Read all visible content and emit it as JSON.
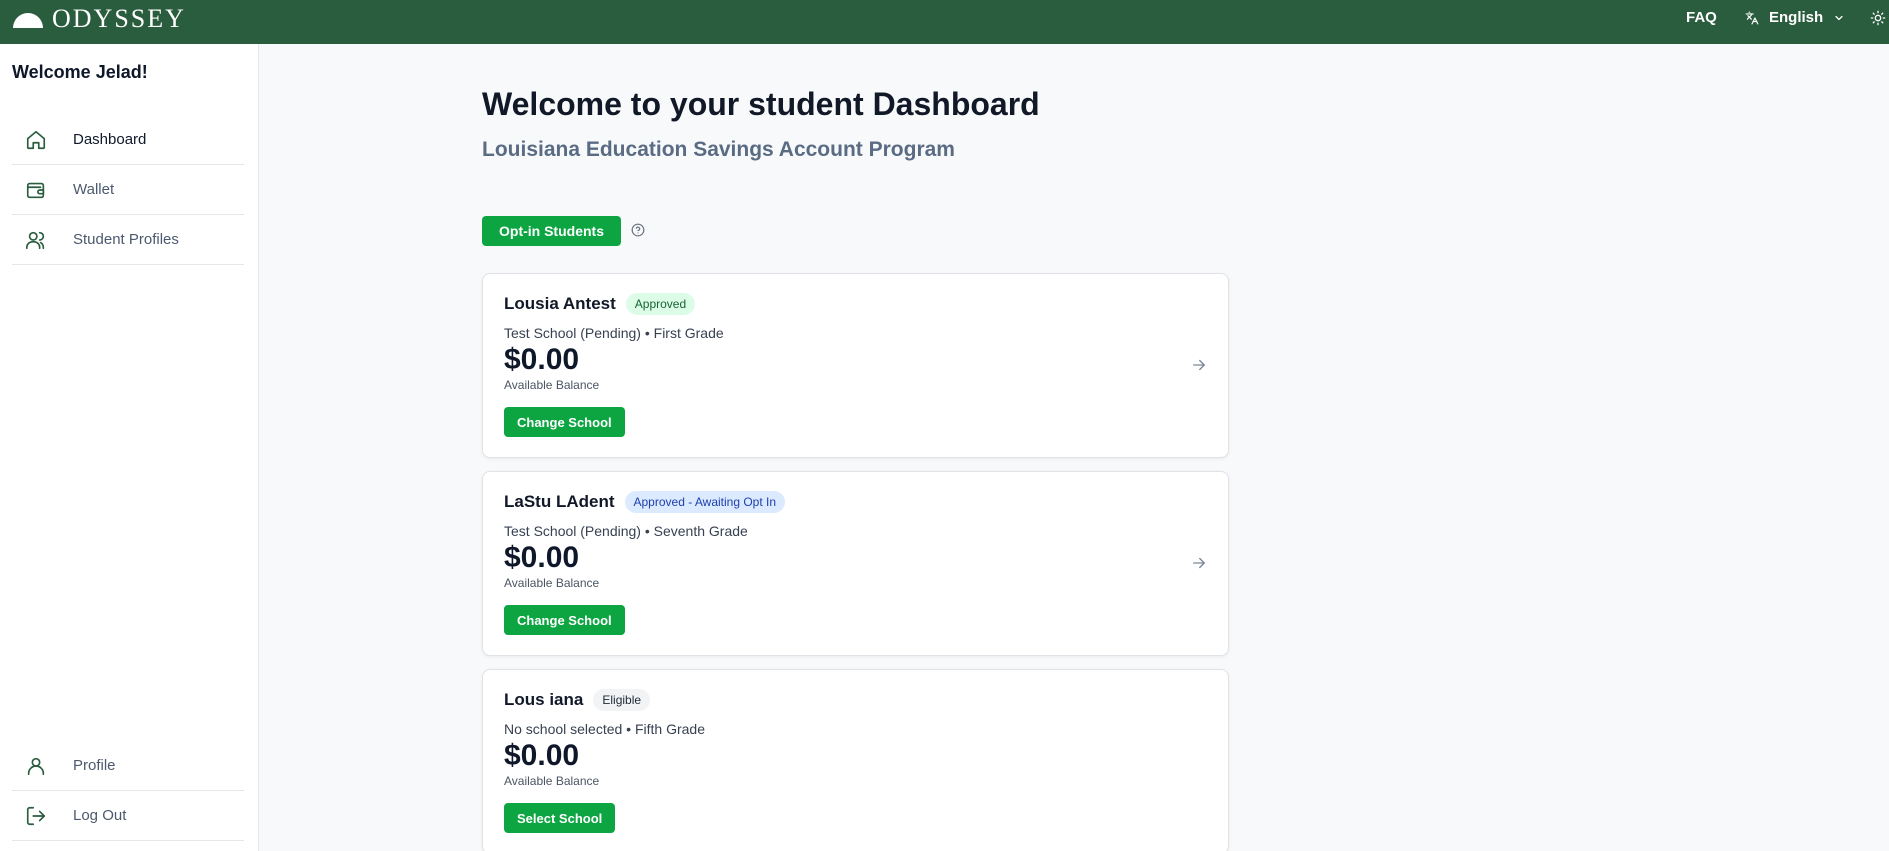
{
  "topbar": {
    "logo_text": "ODYSSEY",
    "faq": "FAQ",
    "language": "English",
    "icons": [
      "logo-dome-icon",
      "translate-icon",
      "chevron-down-icon",
      "sun-icon"
    ]
  },
  "sidebar": {
    "welcome": "Welcome Jelad!",
    "nav": [
      {
        "label": "Dashboard",
        "icon": "home-icon",
        "active": true
      },
      {
        "label": "Wallet",
        "icon": "wallet-icon",
        "active": false
      },
      {
        "label": "Student Profiles",
        "icon": "users-icon",
        "active": false
      }
    ],
    "bottom_nav": [
      {
        "label": "Profile",
        "icon": "user-icon"
      },
      {
        "label": "Log Out",
        "icon": "logout-icon"
      }
    ]
  },
  "main": {
    "title": "Welcome to your student Dashboard",
    "subtitle": "Louisiana Education Savings Account Program",
    "optin_button": "Opt-in Students"
  },
  "students": [
    {
      "name": "Lousia Antest",
      "status": "Approved",
      "school_grade": "Test School (Pending) • First Grade",
      "balance": "$0.00",
      "balance_label": "Available Balance",
      "action": "Change School"
    },
    {
      "name": "LaStu LAdent",
      "status": "Approved - Awaiting Opt In",
      "school_grade": "Test School (Pending) • Seventh Grade",
      "balance": "$0.00",
      "balance_label": "Available Balance",
      "action": "Change School"
    },
    {
      "name": "Lous iana",
      "status": "Eligible",
      "school_grade": "No school selected • Fifth Grade",
      "balance": "$0.00",
      "balance_label": "Available Balance",
      "action": "Select School"
    }
  ],
  "colors": {
    "topbar": "#2a5c3e",
    "primary_button": "#0ca541",
    "approved_badge": "#dcfce7",
    "awaiting_badge": "#dbeafe",
    "eligible_badge": "#f1f3f5"
  }
}
